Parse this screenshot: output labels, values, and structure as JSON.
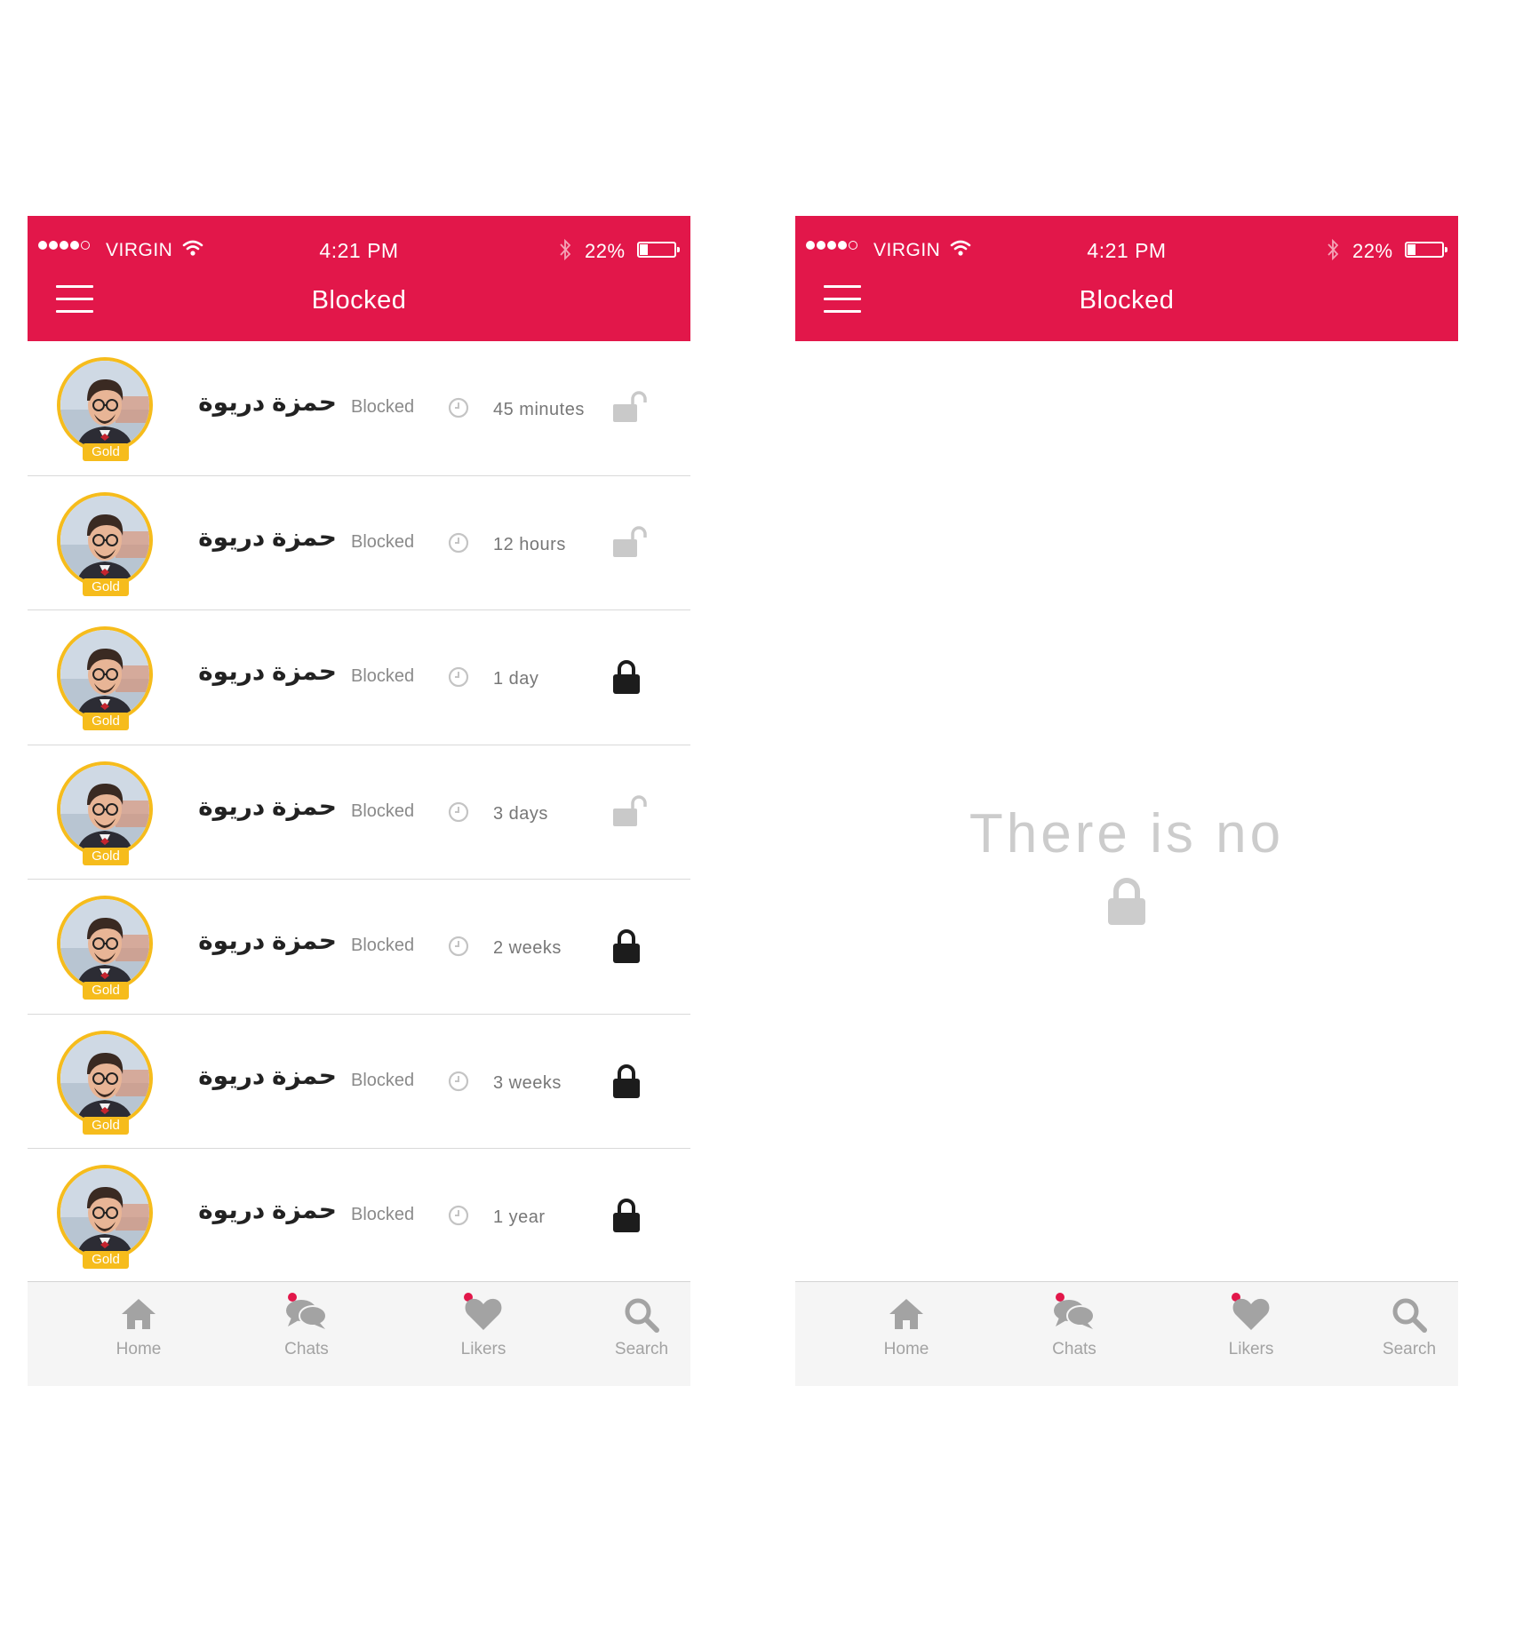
{
  "status_bar": {
    "carrier": "VIRGIN",
    "time": "4:21 PM",
    "battery": "22%"
  },
  "header": {
    "title": "Blocked"
  },
  "blocked_list": {
    "items": [
      {
        "name": "حمزة دريوة",
        "badge": "Gold",
        "status": "Blocked",
        "duration": "45 minutes",
        "lock_state": "unlocked"
      },
      {
        "name": "حمزة دريوة",
        "badge": "Gold",
        "status": "Blocked",
        "duration": "12 hours",
        "lock_state": "unlocked"
      },
      {
        "name": "حمزة دريوة",
        "badge": "Gold",
        "status": "Blocked",
        "duration": "1 day",
        "lock_state": "locked"
      },
      {
        "name": "حمزة دريوة",
        "badge": "Gold",
        "status": "Blocked",
        "duration": "3 days",
        "lock_state": "unlocked"
      },
      {
        "name": "حمزة دريوة",
        "badge": "Gold",
        "status": "Blocked",
        "duration": "2 weeks",
        "lock_state": "locked"
      },
      {
        "name": "حمزة دريوة",
        "badge": "Gold",
        "status": "Blocked",
        "duration": "3 weeks",
        "lock_state": "locked"
      },
      {
        "name": "حمزة دريوة",
        "badge": "Gold",
        "status": "Blocked",
        "duration": "1 year",
        "lock_state": "locked"
      }
    ]
  },
  "empty_state": {
    "message": "There is no"
  },
  "tabbar": {
    "home": "Home",
    "chats": "Chats",
    "likers": "Likers",
    "search": "Search"
  },
  "colors": {
    "brand": "#e2174a",
    "gold": "#f6bc1c",
    "inactive_icon": "#a3a3a3",
    "lock_locked": "#1c1c1c",
    "lock_unlocked": "#c9c9c9"
  },
  "icons": [
    "menu-icon",
    "wifi-icon",
    "bluetooth-icon",
    "battery-icon",
    "clock-icon",
    "lock-icon",
    "unlock-icon",
    "home-icon",
    "chats-icon",
    "heart-icon",
    "search-icon"
  ]
}
